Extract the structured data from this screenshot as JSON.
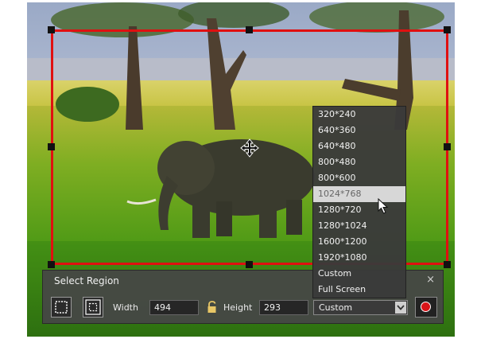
{
  "panel": {
    "title": "Select Region",
    "close_glyph": "×",
    "width_label": "Width",
    "width_value": "494",
    "height_label": "Height",
    "height_value": "293",
    "size_selected": "Custom"
  },
  "size_options": [
    {
      "label": "320*240"
    },
    {
      "label": "640*360"
    },
    {
      "label": "640*480"
    },
    {
      "label": "800*480"
    },
    {
      "label": "800*600"
    },
    {
      "label": "1024*768",
      "highlighted": true
    },
    {
      "label": "1280*720"
    },
    {
      "label": "1280*1024"
    },
    {
      "label": "1600*1200"
    },
    {
      "label": "1920*1080"
    },
    {
      "label": "Custom"
    },
    {
      "label": "Full Screen"
    }
  ],
  "colors": {
    "selection_border": "#e01010",
    "record_dot": "#d81418",
    "highlight_option": "#d7d7d7"
  },
  "icons": [
    "move-icon",
    "select-region-icon",
    "fullscreen-region-icon",
    "lock-icon",
    "dropdown-arrow-icon",
    "record-icon",
    "mouse-cursor-icon"
  ]
}
